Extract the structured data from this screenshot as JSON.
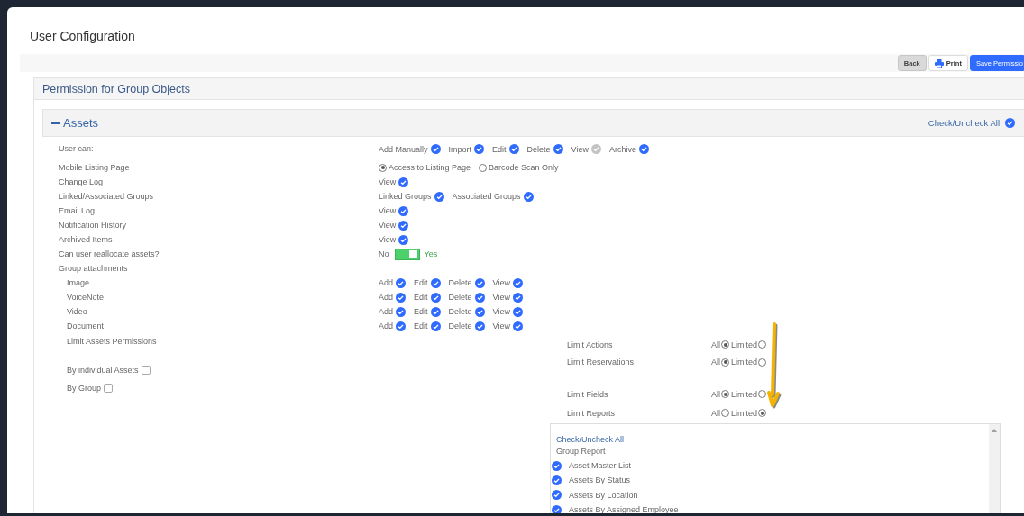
{
  "page": {
    "title": "User Configuration"
  },
  "toolbar": {
    "buttons": [
      {
        "label": "Back",
        "kind": "back"
      },
      {
        "label": "Print",
        "kind": "print"
      },
      {
        "label": "Save Permissio",
        "kind": "primary"
      }
    ]
  },
  "panel": {
    "title": "Permission for Group Objects"
  },
  "section": {
    "title": "Assets",
    "expanded": true,
    "check_all": {
      "label": "Check/Uncheck All",
      "checked": true
    }
  },
  "rows": [
    {
      "label": "User can:",
      "kind": "checks",
      "options": [
        {
          "label": "Add Manually",
          "checked": true
        },
        {
          "label": "Import",
          "checked": true
        },
        {
          "label": "Edit",
          "checked": true
        },
        {
          "label": "Delete",
          "checked": true
        },
        {
          "label": "View",
          "checked": false
        },
        {
          "label": "Archive",
          "checked": true
        }
      ]
    },
    {
      "label": "Mobile Listing Page",
      "kind": "radios",
      "options": [
        {
          "label": "Access to Listing Page",
          "selected": true
        },
        {
          "label": "Barcode Scan Only",
          "selected": false
        }
      ]
    },
    {
      "label": "Change Log",
      "kind": "checks",
      "options": [
        {
          "label": "View",
          "checked": true
        }
      ]
    },
    {
      "label": "Linked/Associated Groups",
      "kind": "checks",
      "options": [
        {
          "label": "Linked Groups",
          "checked": true
        },
        {
          "label": "Associated Groups",
          "checked": true
        }
      ]
    },
    {
      "label": "Email Log",
      "kind": "checks",
      "options": [
        {
          "label": "View",
          "checked": true
        }
      ]
    },
    {
      "label": "Notification History",
      "kind": "checks",
      "options": [
        {
          "label": "View",
          "checked": true
        }
      ]
    },
    {
      "label": "Archived Items",
      "kind": "checks",
      "options": [
        {
          "label": "View",
          "checked": true
        }
      ]
    },
    {
      "label": "Can user reallocate assets?",
      "kind": "toggle",
      "off_label": "No",
      "on_label": "Yes",
      "on": true
    },
    {
      "label": "Group attachments",
      "kind": "group",
      "children": [
        {
          "label": "Image",
          "kind": "checks",
          "options": [
            {
              "label": "Add",
              "checked": true
            },
            {
              "label": "Edit",
              "checked": true
            },
            {
              "label": "Delete",
              "checked": true
            },
            {
              "label": "View",
              "checked": true
            }
          ]
        },
        {
          "label": "VoiceNote",
          "kind": "checks",
          "options": [
            {
              "label": "Add",
              "checked": true
            },
            {
              "label": "Edit",
              "checked": true
            },
            {
              "label": "Delete",
              "checked": true
            },
            {
              "label": "View",
              "checked": true
            }
          ]
        },
        {
          "label": "Video",
          "kind": "checks",
          "options": [
            {
              "label": "Add",
              "checked": true
            },
            {
              "label": "Edit",
              "checked": true
            },
            {
              "label": "Delete",
              "checked": true
            },
            {
              "label": "View",
              "checked": true
            }
          ]
        },
        {
          "label": "Document",
          "kind": "checks",
          "options": [
            {
              "label": "Add",
              "checked": true
            },
            {
              "label": "Edit",
              "checked": true
            },
            {
              "label": "Delete",
              "checked": true
            },
            {
              "label": "View",
              "checked": true
            }
          ]
        }
      ]
    }
  ],
  "limit_assets": {
    "title": "Limit Assets Permissions",
    "options": [
      {
        "label": "By individual Assets",
        "checked": false
      },
      {
        "label": "By Group",
        "checked": false
      }
    ]
  },
  "limits": [
    {
      "label": "Limit Actions",
      "options": [
        {
          "label": "All",
          "selected": true
        },
        {
          "label": "Limited",
          "selected": false
        }
      ]
    },
    {
      "label": "Limit Reservations",
      "options": [
        {
          "label": "All",
          "selected": true
        },
        {
          "label": "Limited",
          "selected": false
        }
      ]
    },
    {
      "label": "Limit Fields",
      "options": [
        {
          "label": "All",
          "selected": true
        },
        {
          "label": "Limited",
          "selected": false
        }
      ]
    },
    {
      "label": "Limit Reports",
      "options": [
        {
          "label": "All",
          "selected": false
        },
        {
          "label": "Limited",
          "selected": true
        }
      ]
    }
  ],
  "reports": {
    "check_all": "Check/Uncheck All",
    "group": "Group Report",
    "items": [
      {
        "label": "Asset Master List",
        "checked": true
      },
      {
        "label": "Assets By Status",
        "checked": true
      },
      {
        "label": "Assets By Location",
        "checked": true
      },
      {
        "label": "Assets By Assigned Employee",
        "checked": true
      }
    ]
  }
}
